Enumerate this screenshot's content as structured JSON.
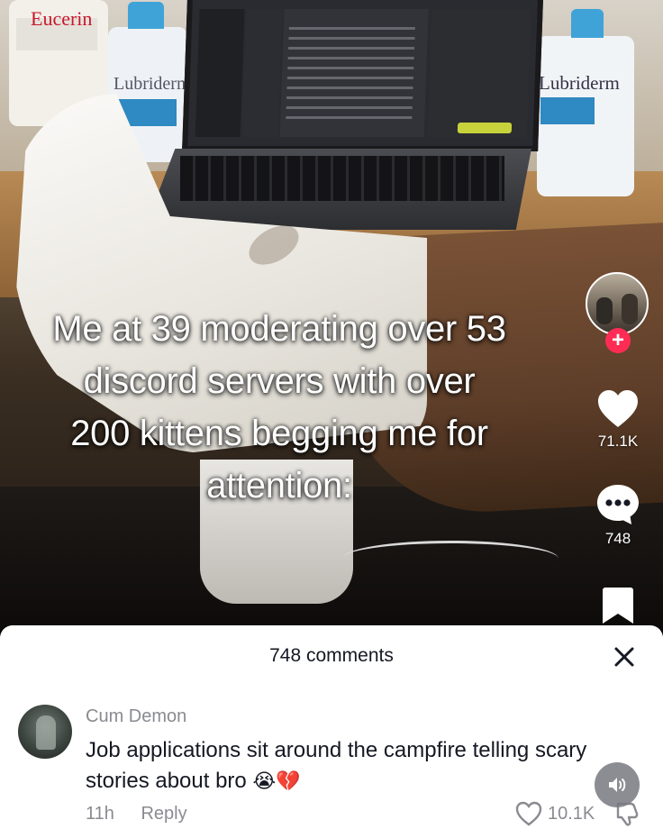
{
  "video": {
    "caption_lines": [
      "Me at 39 moderating over 53",
      "discord servers with over",
      "200 kittens begging me for",
      "attention:"
    ],
    "background_labels": {
      "bottle_left": "Eucerin",
      "bottle_middle": "Lubriderm",
      "bottle_right": "Lubriderm"
    }
  },
  "rail": {
    "follow_icon": "+",
    "likes": "71.1K",
    "comments": "748"
  },
  "comments_sheet": {
    "title": "748 comments",
    "comment": {
      "username": "Cum Demon",
      "text": "Job applications sit around the campfire telling scary stories about bro",
      "emojis": "😭💔",
      "time": "11h",
      "reply_label": "Reply",
      "likes": "10.1K"
    }
  },
  "colors": {
    "accent": "#fe2c55",
    "text_primary": "#161823",
    "text_secondary": "#8a8b91"
  }
}
